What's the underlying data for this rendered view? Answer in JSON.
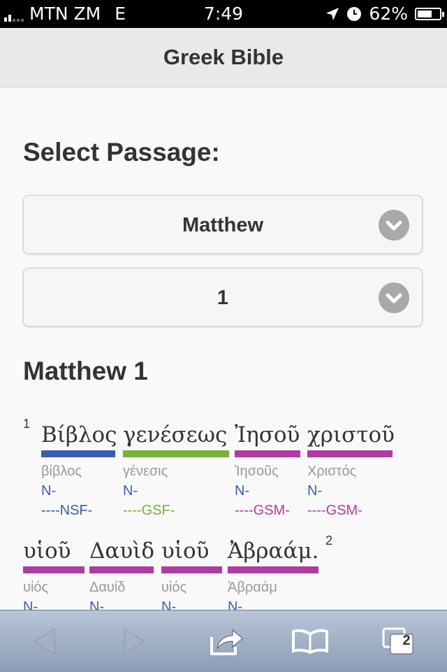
{
  "status": {
    "carrier": "MTN ZM",
    "network": "E",
    "time": "7:49",
    "battery": "62%"
  },
  "header": {
    "title": "Greek Bible"
  },
  "select_heading": "Select Passage:",
  "book_select": {
    "value": "Matthew"
  },
  "chapter_select": {
    "value": "1"
  },
  "chapter_heading": "Matthew 1",
  "colors": {
    "noun_nsf": "#3a5bb0",
    "noun_gsf": "#7ab03a",
    "noun_gsm": "#b23aa4",
    "toolbar": "#9aaac0"
  },
  "verses": [
    {
      "number": "1",
      "words": [
        {
          "greek": "Βίβλος",
          "lemma": "βίβλος",
          "pos": "N-",
          "parse": "----NSF-"
        },
        {
          "greek": "γενέσεως",
          "lemma": "γένεσις",
          "pos": "N-",
          "parse": "----GSF-"
        },
        {
          "greek": "Ἰησοῦ",
          "lemma": "Ἰησοῦς",
          "pos": "N-",
          "parse": "----GSM-"
        },
        {
          "greek": "χριστοῦ",
          "lemma": "Χριστός",
          "pos": "N-",
          "parse": "----GSM-"
        },
        {
          "greek": "υἱοῦ",
          "lemma": "υἱός",
          "pos": "N-",
          "parse": ""
        },
        {
          "greek": "Δαυὶδ",
          "lemma": "Δαυίδ",
          "pos": "N-",
          "parse": ""
        },
        {
          "greek": "υἱοῦ",
          "lemma": "υἱός",
          "pos": "N-",
          "parse": ""
        },
        {
          "greek": "Ἀβραάμ.",
          "lemma": "Ἀβραάμ",
          "pos": "N-",
          "parse": ""
        }
      ]
    },
    {
      "number": "2"
    }
  ],
  "toolbar": {
    "tabs_count": "2"
  },
  "icons": [
    "back-icon",
    "forward-icon",
    "share-icon",
    "bookmarks-icon",
    "tabs-icon",
    "chevron-down-icon",
    "location-icon",
    "clock-icon",
    "battery-icon",
    "signal-icon"
  ]
}
